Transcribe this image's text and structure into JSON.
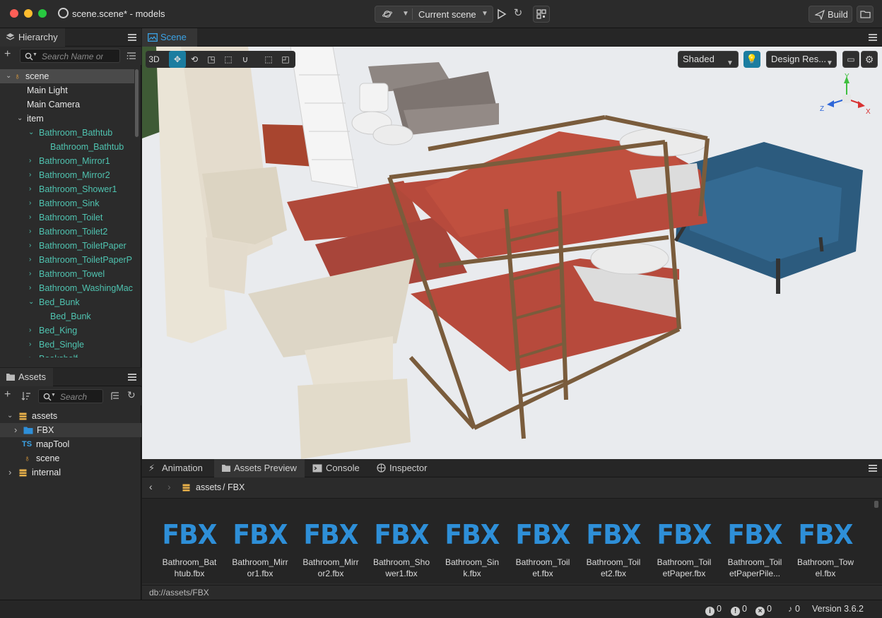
{
  "window": {
    "title": "scene.scene* - models"
  },
  "toolbar": {
    "scene_selector": "Current scene",
    "build_label": "Build"
  },
  "hierarchy": {
    "tab_label": "Hierarchy",
    "search_placeholder": "Search Name or",
    "rows": [
      {
        "label": "scene",
        "color": "white"
      },
      {
        "label": "Main Light",
        "color": "white"
      },
      {
        "label": "Main Camera",
        "color": "white"
      },
      {
        "label": "item",
        "color": "white"
      },
      {
        "label": "Bathroom_Bathtub",
        "color": "teal"
      },
      {
        "label": "Bathroom_Bathtub",
        "color": "teal"
      },
      {
        "label": "Bathroom_Mirror1",
        "color": "teal"
      },
      {
        "label": "Bathroom_Mirror2",
        "color": "teal"
      },
      {
        "label": "Bathroom_Shower1",
        "color": "teal"
      },
      {
        "label": "Bathroom_Sink",
        "color": "teal"
      },
      {
        "label": "Bathroom_Toilet",
        "color": "teal"
      },
      {
        "label": "Bathroom_Toilet2",
        "color": "teal"
      },
      {
        "label": "Bathroom_ToiletPaper",
        "color": "teal"
      },
      {
        "label": "Bathroom_ToiletPaperP",
        "color": "teal"
      },
      {
        "label": "Bathroom_Towel",
        "color": "teal"
      },
      {
        "label": "Bathroom_WashingMac",
        "color": "teal"
      },
      {
        "label": "Bed_Bunk",
        "color": "teal"
      },
      {
        "label": "Bed_Bunk",
        "color": "teal"
      },
      {
        "label": "Bed_King",
        "color": "teal"
      },
      {
        "label": "Bed_Single",
        "color": "teal"
      },
      {
        "label": "Bookshelf",
        "color": "teal"
      }
    ]
  },
  "assets": {
    "tab_label": "Assets",
    "search_placeholder": "Search",
    "rows": [
      {
        "label": "assets"
      },
      {
        "label": "FBX"
      },
      {
        "label": "mapTool",
        "badge": "TS"
      },
      {
        "label": "scene"
      },
      {
        "label": "internal"
      }
    ]
  },
  "scene": {
    "tab_label": "Scene",
    "mode_3d": "3D",
    "shading": "Shaded",
    "resolution": "Design Res...",
    "gizmo_axes": {
      "y": "Y",
      "z": "Z",
      "x": "X"
    }
  },
  "bottom": {
    "tabs": [
      "Animation",
      "Assets Preview",
      "Console",
      "Inspector"
    ],
    "breadcrumb": {
      "root": "assets",
      "sep": "/",
      "leaf": "FBX"
    },
    "asset_badge": "FBX",
    "files": [
      "Bathroom_Bathtub.fbx",
      "Bathroom_Mirror1.fbx",
      "Bathroom_Mirror2.fbx",
      "Bathroom_Shower1.fbx",
      "Bathroom_Sink.fbx",
      "Bathroom_Toilet.fbx",
      "Bathroom_Toilet2.fbx",
      "Bathroom_ToiletPaper.fbx",
      "Bathroom_ToiletPaperPile...",
      "Bathroom_Towel.fbx"
    ],
    "path": "db://assets/FBX"
  },
  "status": {
    "info_count": "0",
    "warning_count": "0",
    "error_count": "0",
    "notification_count": "0",
    "version": "Version 3.6.2"
  },
  "colors": {
    "accent": "#1b7da0",
    "teal_text": "#4fc3b0",
    "fbx_blue": "#2e8fd8"
  }
}
